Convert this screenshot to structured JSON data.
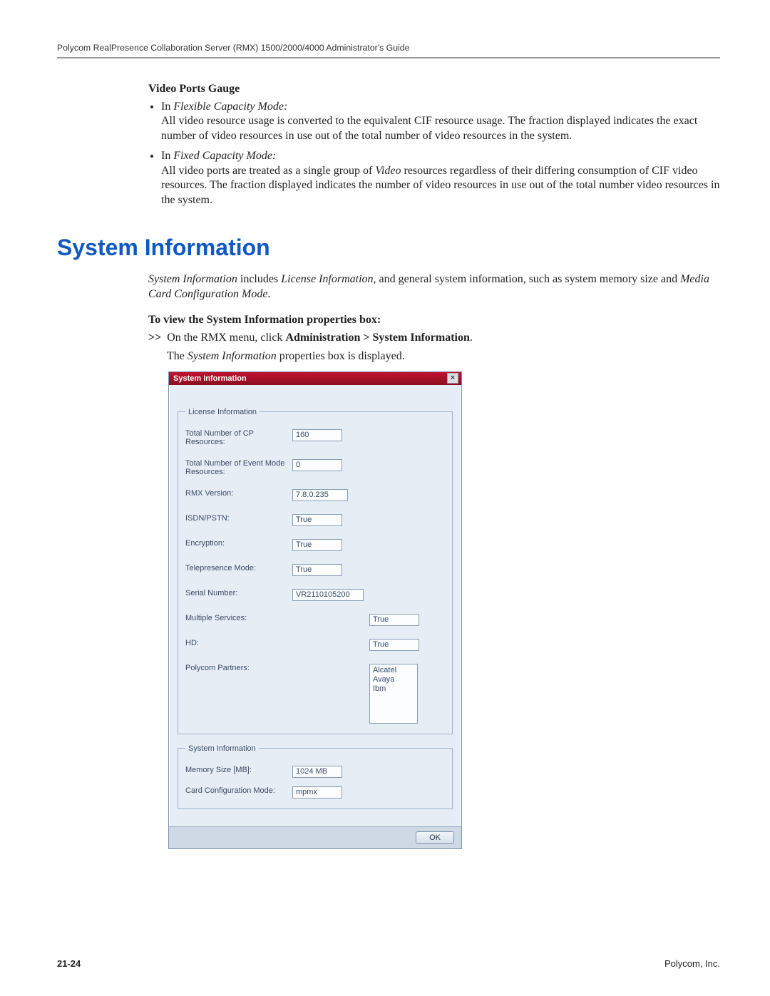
{
  "header": {
    "guide_title": "Polycom RealPresence Collaboration Server (RMX) 1500/2000/4000 Administrator's Guide"
  },
  "video_ports": {
    "heading": "Video Ports Gauge",
    "b1_lead": "In ",
    "b1_mode": "Flexible Capacity Mode:",
    "b1_text": "All video resource usage is converted to the equivalent CIF resource usage. The fraction displayed indicates the exact number of video resources in use out of the total number of video resources in the system.",
    "b2_lead": "In ",
    "b2_mode": "Fixed Capacity Mode:",
    "b2_text_a": "All video ports are treated as a single group of ",
    "b2_text_video": "Video",
    "b2_text_b": " resources regardless of their differing consumption of CIF video resources. The fraction displayed indicates the number of video resources in use out of the total number video resources in the system."
  },
  "sysinfo": {
    "heading": "System Information",
    "intro_1": "System Information",
    "intro_2": " includes ",
    "intro_3": "License Information",
    "intro_4": ", and general system information, such as system memory size and ",
    "intro_5": "Media Card Configuration Mode",
    "intro_6": ".",
    "proc_heading": "To view the System Information properties box:",
    "step_arrows": ">>",
    "step_a": "On the RMX menu, click ",
    "step_path": "Administration > System Information",
    "step_b": ".",
    "result_a": "The ",
    "result_b": "System Information",
    "result_c": " properties box is displayed."
  },
  "dialog": {
    "title": "System Information",
    "close_glyph": "×",
    "license_legend": "License Information",
    "labels": {
      "cp": "Total Number of CP Resources:",
      "event": "Total Number of Event Mode Resources:",
      "rmx": "RMX Version:",
      "isdn": "ISDN/PSTN:",
      "enc": "Encryption:",
      "tp": "Telepresence Mode:",
      "serial": "Serial Number:",
      "multi": "Multiple Services:",
      "hd": "HD:",
      "partners": "Polycom Partners:"
    },
    "values": {
      "cp": "160",
      "event": "0",
      "rmx": "7.8.0.235",
      "isdn": "True",
      "enc": "True",
      "tp": "True",
      "serial": "VR2110105200",
      "multi": "True",
      "hd": "True",
      "partners": [
        "Alcatel",
        "Avaya",
        "Ibm"
      ]
    },
    "system_legend": "System Information",
    "sys_labels": {
      "mem": "Memory Size [MB]:",
      "card": "Card Configuration Mode:"
    },
    "sys_values": {
      "mem": "1024 MB",
      "card": "mpmx"
    },
    "ok": "OK"
  },
  "footer": {
    "pagenum": "21-24",
    "company": "Polycom, Inc."
  }
}
